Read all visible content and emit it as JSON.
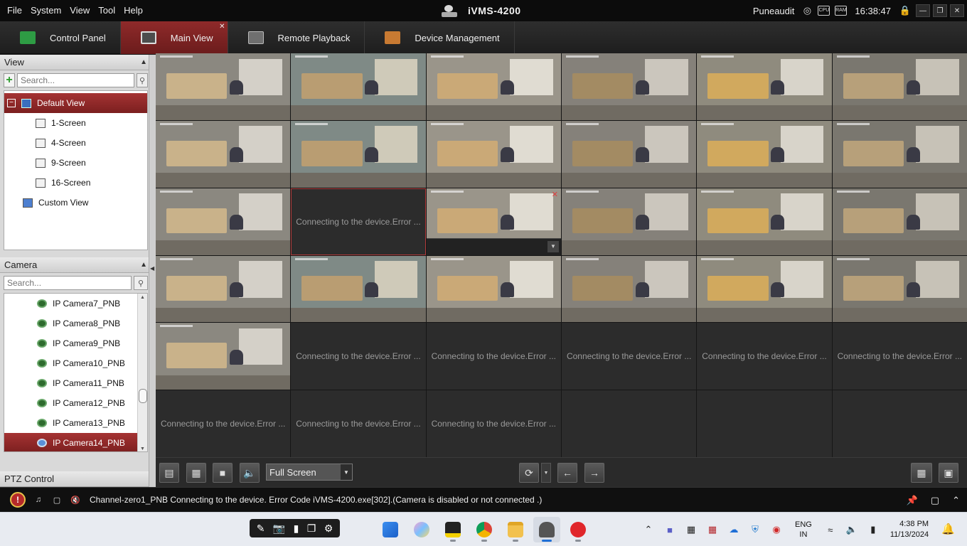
{
  "window": {
    "title": "iVMS-4200",
    "menu": [
      "File",
      "System",
      "View",
      "Tool",
      "Help"
    ],
    "user": "Puneaudit",
    "clock": "16:38:47",
    "ram_badge": "RAM"
  },
  "tabs": [
    {
      "label": "Control Panel",
      "active": false,
      "icon_color": "#2e9c44"
    },
    {
      "label": "Main View",
      "active": true,
      "icon_color": "#5a5a5a"
    },
    {
      "label": "Remote Playback",
      "active": false,
      "icon_color": "#6f6f6f"
    },
    {
      "label": "Device Management",
      "active": false,
      "icon_color": "#c87a32"
    }
  ],
  "view_panel": {
    "title": "View",
    "search_placeholder": "Search...",
    "root": "Default View",
    "items": [
      "1-Screen",
      "4-Screen",
      "9-Screen",
      "16-Screen"
    ],
    "custom": "Custom View"
  },
  "camera_panel": {
    "title": "Camera",
    "search_placeholder": "Search...",
    "items": [
      "IP Camera7_PNB",
      "IP Camera8_PNB",
      "IP Camera9_PNB",
      "IP Camera10_PNB",
      "IP Camera11_PNB",
      "IP Camera12_PNB",
      "IP Camera13_PNB",
      "IP Camera14_PNB"
    ],
    "selected": "IP Camera14_PNB"
  },
  "ptz_panel": {
    "title": "PTZ Control"
  },
  "grid": {
    "error_text": "Connecting to the device.Error ...",
    "cells": [
      "video",
      "video",
      "video",
      "video",
      "video",
      "video",
      "video",
      "video",
      "video",
      "video",
      "video",
      "video",
      "video",
      "error",
      "video-ctrl",
      "video",
      "video",
      "video",
      "video",
      "video",
      "video",
      "video",
      "video",
      "video",
      "video",
      "error",
      "error",
      "error",
      "error",
      "error",
      "error",
      "error",
      "error",
      "empty",
      "empty",
      "empty"
    ]
  },
  "toolbar": {
    "screen_mode": "Full Screen"
  },
  "status": {
    "message": "Channel-zero1_PNB Connecting to the device. Error Code iVMS-4200.exe[302].(Camera is disabled or not connected .)"
  },
  "taskbar": {
    "lang_top": "ENG",
    "lang_bottom": "IN",
    "time": "4:38 PM",
    "date": "11/13/2024"
  },
  "colors": {
    "accent_red": "#8f2a2a",
    "error_text": "#9a9a9a"
  }
}
